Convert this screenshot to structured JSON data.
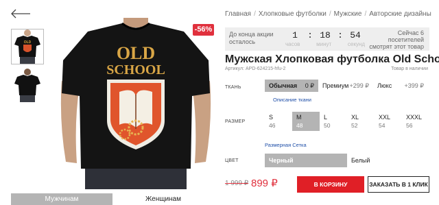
{
  "breadcrumb": [
    {
      "label": "Главная"
    },
    {
      "label": "Хлопковые футболки"
    },
    {
      "label": "Мужские"
    },
    {
      "label": "Авторские дизайны"
    }
  ],
  "breadcrumb_separator": "/",
  "discount_badge": "-56%",
  "tshirt_print": {
    "line1": "OLD",
    "line2": "SCHOOL"
  },
  "timer": {
    "label": "До конца акции осталось",
    "hours": "1",
    "minutes": "18",
    "seconds": "54",
    "unit_hours": "часов",
    "unit_minutes": "минут",
    "unit_seconds": "секунд",
    "viewers_text": "Сейчас 6 посетителей смотрят этот товар"
  },
  "product": {
    "title": "Мужская Хлопковая футболка Old School",
    "sku": "Артикул: APD-624215-hfu-2",
    "stock": "Товар в наличии"
  },
  "fabric": {
    "label": "ТКАНЬ",
    "options": [
      {
        "name": "Обычная",
        "price": "0 ₽",
        "selected": true
      },
      {
        "name": "Премиум",
        "price": "+299 ₽",
        "selected": false
      },
      {
        "name": "Люкс",
        "price": "+399 ₽",
        "selected": false
      }
    ],
    "description_link": "Описание ткани"
  },
  "size": {
    "label": "РАЗМЕР",
    "options": [
      {
        "size": "S",
        "num": "46",
        "selected": false
      },
      {
        "size": "M",
        "num": "48",
        "selected": true
      },
      {
        "size": "L",
        "num": "50",
        "selected": false
      },
      {
        "size": "XL",
        "num": "52",
        "selected": false
      },
      {
        "size": "XXL",
        "num": "54",
        "selected": false
      },
      {
        "size": "XXXL",
        "num": "56",
        "selected": false
      }
    ],
    "chart_link": "Размерная Сетка"
  },
  "color": {
    "label": "ЦВЕТ",
    "options": [
      {
        "name": "Черный",
        "selected": true
      },
      {
        "name": "Белый",
        "selected": false
      }
    ]
  },
  "price": {
    "old": "1 999 ₽",
    "new": "899 ₽"
  },
  "buttons": {
    "cart": "В КОРЗИНУ",
    "one_click": "ЗАКАЗАТЬ В 1 КЛИК"
  },
  "gender_tabs": [
    {
      "label": "Мужчинам",
      "active": true
    },
    {
      "label": "Женщинам",
      "active": false
    }
  ],
  "colors": {
    "accent_red": "#e01f26",
    "badge_red": "#e0303d",
    "selected_gray": "#b4b4b4",
    "link_blue": "#1f4fa8"
  }
}
